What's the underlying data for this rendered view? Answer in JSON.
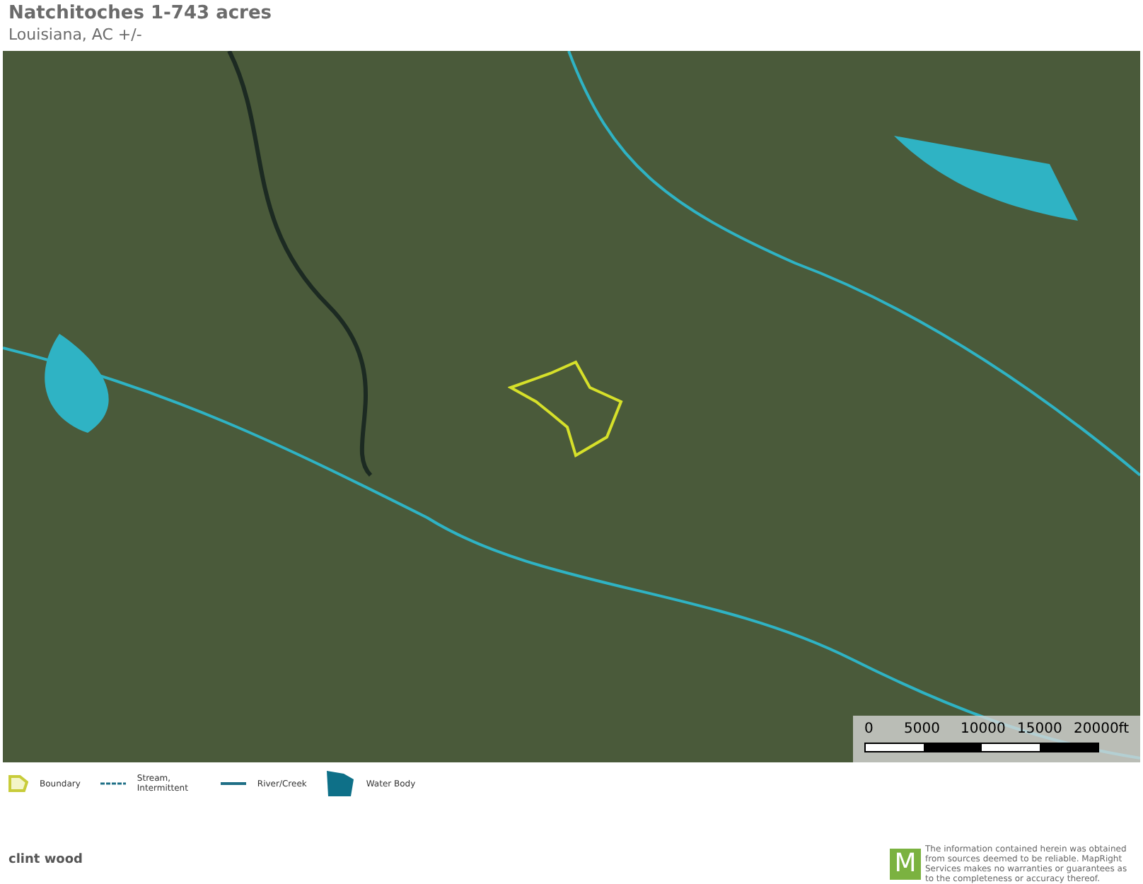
{
  "header": {
    "title": "Natchitoches 1-743 acres",
    "subtitle": "Louisiana,  AC +/-"
  },
  "scale_bar": {
    "labels": [
      "0",
      "5000",
      "10000",
      "15000",
      "20000ft"
    ]
  },
  "legend": [
    {
      "kind": "boundary",
      "label": "Boundary"
    },
    {
      "kind": "stream",
      "label": "Stream, Intermittent"
    },
    {
      "kind": "river",
      "label": "River/Creek"
    },
    {
      "kind": "water",
      "label": "Water Body"
    }
  ],
  "footer": {
    "author": "clint wood",
    "logo_letter": "M",
    "disclaimer": "The information contained herein was obtained from sources deemed to be reliable. MapRight Services makes no warranties or guarantees as to the completeness or accuracy thereof."
  }
}
